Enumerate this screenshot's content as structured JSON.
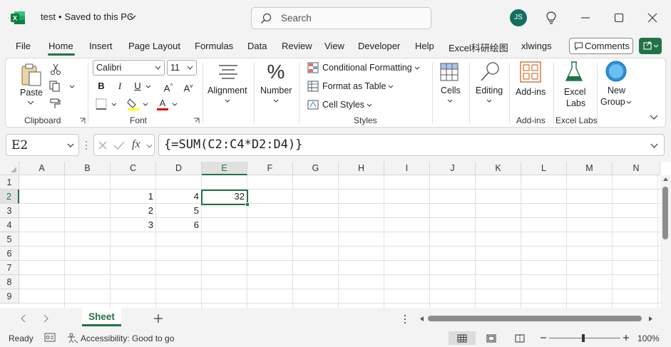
{
  "titlebar": {
    "file_name": "test",
    "separator": "•",
    "save_status": "Saved to this PC",
    "search_placeholder": "Search",
    "user_initials": "JS"
  },
  "tabs": [
    {
      "label": "File"
    },
    {
      "label": "Home",
      "active": true
    },
    {
      "label": "Insert"
    },
    {
      "label": "Page Layout"
    },
    {
      "label": "Formulas"
    },
    {
      "label": "Data"
    },
    {
      "label": "Review"
    },
    {
      "label": "View"
    },
    {
      "label": "Developer"
    },
    {
      "label": "Help"
    },
    {
      "label": "Excel科研绘图"
    },
    {
      "label": "xlwings"
    }
  ],
  "comments_label": "Comments",
  "ribbon": {
    "clipboard": {
      "paste": "Paste",
      "group": "Clipboard"
    },
    "font": {
      "name": "Calibri",
      "size": "11",
      "group": "Font"
    },
    "alignment": "Alignment",
    "number": "Number",
    "styles": {
      "conditional": "Conditional Formatting",
      "table": "Format as Table",
      "cell_styles": "Cell Styles",
      "group": "Styles"
    },
    "cells": "Cells",
    "editing": "Editing",
    "addins": {
      "button": "Add-ins",
      "group": "Add-ins"
    },
    "excel_labs": {
      "line1": "Excel",
      "line2": "Labs",
      "group": "Excel Labs"
    },
    "new_group": {
      "line1": "New",
      "line2": "Group"
    }
  },
  "formula_bar": {
    "name_box": "E2",
    "formula": "{=SUM(C2:C4*D2:D4)}",
    "fx": "fx"
  },
  "grid": {
    "columns": [
      "A",
      "B",
      "C",
      "D",
      "E",
      "F",
      "G",
      "H",
      "I",
      "J",
      "K",
      "L",
      "M",
      "N"
    ],
    "rows": [
      "1",
      "2",
      "3",
      "4",
      "5",
      "6",
      "7",
      "8",
      "9"
    ],
    "selected_column": "E",
    "selected_row": "2",
    "cells": {
      "C2": "1",
      "D2": "4",
      "E2": "32",
      "C3": "2",
      "D3": "5",
      "C4": "3",
      "D4": "6"
    }
  },
  "sheet_tab": "Sheet",
  "status": {
    "ready": "Ready",
    "accessibility": "Accessibility: Good to go",
    "zoom": "100%"
  },
  "colors": {
    "accent": "#217346",
    "background": "#f3f3f3"
  }
}
